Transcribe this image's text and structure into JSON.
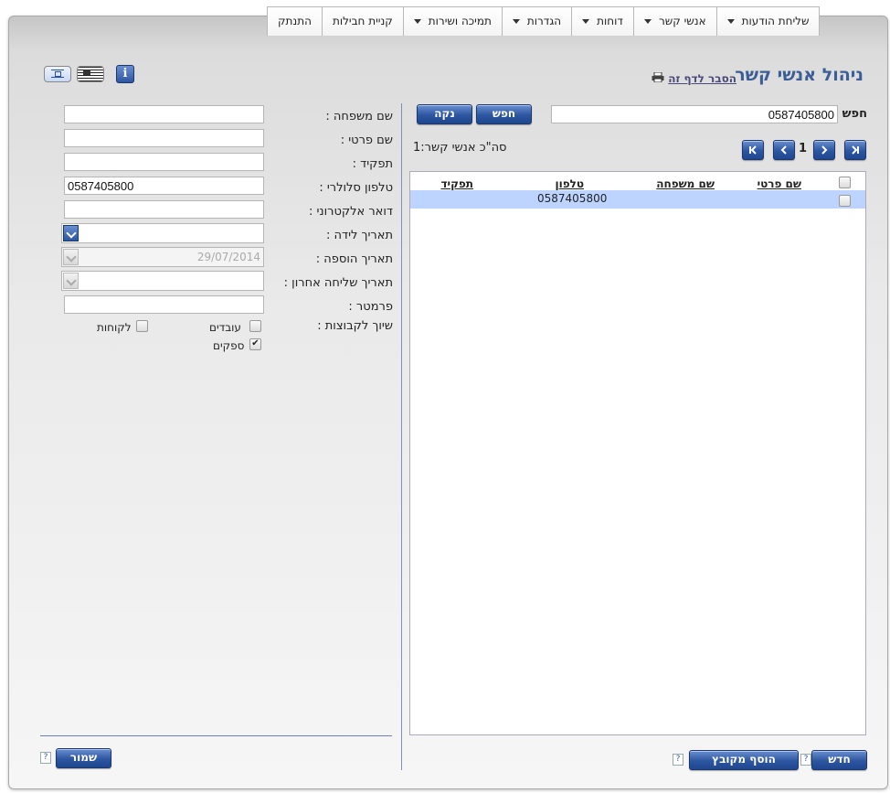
{
  "menu": {
    "items": [
      {
        "label": "שליחת הודעות",
        "has_dropdown": true
      },
      {
        "label": "אנשי קשר",
        "has_dropdown": true
      },
      {
        "label": "דוחות",
        "has_dropdown": true
      },
      {
        "label": "הגדרות",
        "has_dropdown": true
      },
      {
        "label": "תמיכה ושירות",
        "has_dropdown": true
      },
      {
        "label": "קניית חבילות",
        "has_dropdown": false
      },
      {
        "label": "התנתק",
        "has_dropdown": false
      }
    ]
  },
  "page": {
    "title": "ניהול אנשי קשר",
    "help_link": "הסבר לדף זה"
  },
  "search": {
    "label": "חפש",
    "value": "0587405800",
    "search_button": "חפש",
    "clear_button": "נקה"
  },
  "pagination": {
    "current_page": "1",
    "total_label": "סה\"כ אנשי קשר:1"
  },
  "table": {
    "columns": [
      "שם פרטי",
      "שם משפחה",
      "טלפון",
      "תפקיד"
    ],
    "rows": [
      {
        "first_name": "",
        "last_name": "",
        "phone": "0587405800",
        "role": "",
        "selected": false
      }
    ]
  },
  "form": {
    "last_name": {
      "label": "שם משפחה :",
      "value": ""
    },
    "first_name": {
      "label": "שם פרטי :",
      "value": ""
    },
    "role": {
      "label": "תפקיד :",
      "value": ""
    },
    "mobile": {
      "label": "טלפון סלולרי :",
      "value": "0587405800"
    },
    "email": {
      "label": "דואר אלקטרוני :",
      "value": ""
    },
    "birth_date": {
      "label": "תאריך לידה :",
      "value": ""
    },
    "added_date": {
      "label": "תאריך הוספה :",
      "value": "29/07/2014"
    },
    "last_sent_date": {
      "label": "תאריך שליחה אחרון :",
      "value": ""
    },
    "parameter": {
      "label": "פרמטר :",
      "value": ""
    },
    "groups_label": "שיוך לקבוצות :",
    "groups": [
      {
        "name": "עובדים",
        "checked": false
      },
      {
        "name": "לקוחות",
        "checked": false
      },
      {
        "name": "ספקים",
        "checked": true
      }
    ]
  },
  "buttons": {
    "new": "חדש",
    "add_from_file": "הוסף מקובץ",
    "save": "שמור",
    "help_q": "?"
  },
  "icons": {
    "info": "i",
    "flag_il": "flag-israel-icon",
    "flag_us": "flag-usa-icon"
  },
  "colors": {
    "accent": "#2d56a0",
    "title": "#3b5e96",
    "row_highlight": "#bcd4ff"
  }
}
